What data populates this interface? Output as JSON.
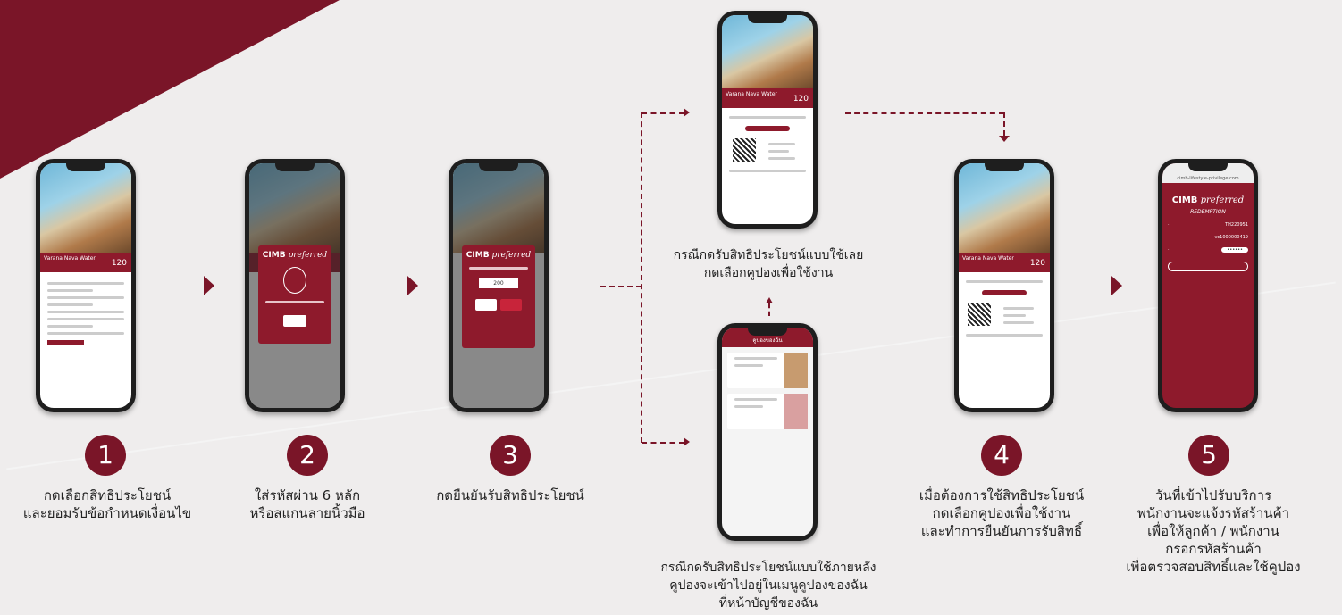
{
  "steps": [
    {
      "num": "1",
      "caption": "กดเลือกสิทธิประโยชน์\nและยอมรับข้อกำหนดเงื่อนไข"
    },
    {
      "num": "2",
      "caption": "ใส่รหัสผ่าน 6 หลัก\nหรือสแกนลายนิ้วมือ"
    },
    {
      "num": "3",
      "caption": "กดยืนยันรับสิทธิประโยชน์"
    },
    {
      "num": "4",
      "caption": "เมื่อต้องการใช้สิทธิประโยชน์\nกดเลือกคูปองเพื่อใช้งาน\nและทำการยืนยันการรับสิทธิ์"
    },
    {
      "num": "5",
      "caption": "วันที่เข้าไปรับบริการ\nพนักงานจะแจ้งรหัสร้านค้า\nเพื่อให้ลูกค้า / พนักงาน\nกรอกรหัสร้านค้า\nเพื่อตรวจสอบสิทธิ์และใช้คูปอง"
    }
  ],
  "branches": {
    "use_now": "กรณีกดรับสิทธิประโยชน์แบบใช้เลย\nกดเลือกคูปองเพื่อใช้งาน",
    "use_later": "กรณีกดรับสิทธิประโยชน์แบบใช้ภายหลัง\nคูปองจะเข้าไปอยู่ในเมนูคูปองของฉัน\nที่หน้าบัญชีของฉัน"
  },
  "screens": {
    "hotel_name": "Varana Nava Water",
    "points": "120",
    "brand_cimb": "CIMB",
    "brand_preferred": "preferred",
    "redemption": "REDEMPTION",
    "otp_value": "200",
    "code_value": "••••••",
    "shop_code": "TH220951",
    "coupon_no": "vc1000000419",
    "url": "cimb-lifestyle-privilege.com",
    "coupon_tab": "คูปองของฉัน"
  },
  "colors": {
    "brand": "#7a1528",
    "background": "#efeded"
  }
}
